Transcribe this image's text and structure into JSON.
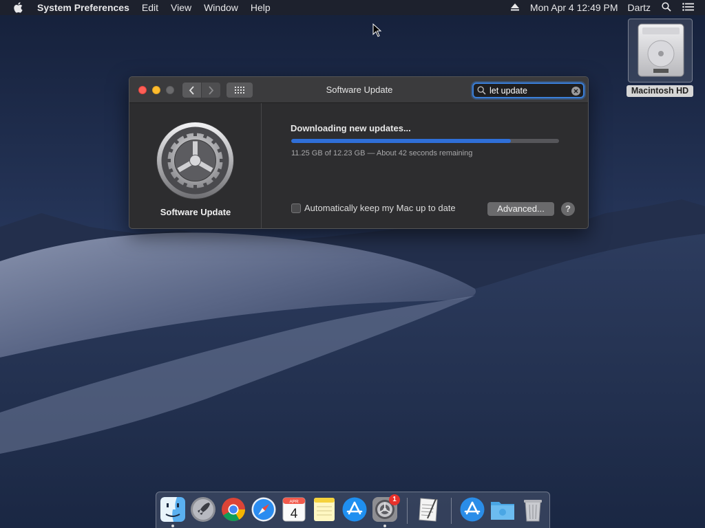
{
  "menubar": {
    "app_name": "System Preferences",
    "items": [
      "Edit",
      "View",
      "Window",
      "Help"
    ],
    "clock": "Mon Apr 4  12:49 PM",
    "user": "Dartz",
    "icons": [
      "apple-logo-icon",
      "eject-icon",
      "spotlight-search-icon",
      "notification-center-icon"
    ]
  },
  "desktop": {
    "hd_label": "Macintosh HD"
  },
  "window": {
    "title": "Software Update",
    "search": {
      "value": "let update"
    },
    "sidebar_title": "Software Update",
    "status_text": "Downloading new updates...",
    "progress_fraction": 0.82,
    "progress_detail": "11.25 GB of 12.23 GB — About 42 seconds remaining",
    "auto_update_label": "Automatically keep my Mac up to date",
    "auto_update_checked": false,
    "advanced_label": "Advanced...",
    "help_label": "?"
  },
  "dock": {
    "items": [
      {
        "name": "finder-icon",
        "running": true
      },
      {
        "name": "launchpad-icon",
        "running": false
      },
      {
        "name": "chrome-icon",
        "running": false
      },
      {
        "name": "safari-icon",
        "running": false
      },
      {
        "name": "calendar-icon",
        "running": false,
        "month": "APR",
        "day": "4"
      },
      {
        "name": "notes-icon",
        "running": false
      },
      {
        "name": "app-store-icon",
        "running": false
      },
      {
        "name": "system-preferences-icon",
        "running": true,
        "badge": "1"
      },
      {
        "name": "textedit-icon",
        "running": false
      },
      {
        "name": "applications-folder-icon",
        "running": false
      },
      {
        "name": "downloads-folder-icon",
        "running": false
      },
      {
        "name": "trash-icon",
        "running": false
      }
    ]
  },
  "colors": {
    "accent": "#2f6fd8",
    "close": "#fe5f57",
    "minimize": "#febc2e",
    "badge": "#e8312b"
  }
}
